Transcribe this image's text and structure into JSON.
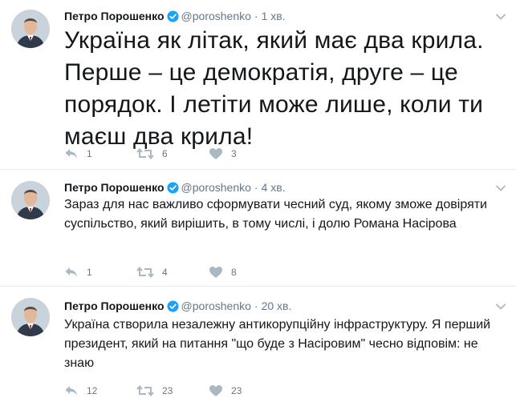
{
  "tweets": [
    {
      "name": "Петро Порошенко",
      "handle": "@poroshenko",
      "separator": "·",
      "time": "1 хв.",
      "text": "Україна як літак, який має два крила. Перше – це демократія, друге – це порядок. І летіти може лише, коли ти маєш два крила!",
      "replies": "1",
      "retweets": "6",
      "likes": "3"
    },
    {
      "name": "Петро Порошенко",
      "handle": "@poroshenko",
      "separator": "·",
      "time": "4 хв.",
      "text": "Зараз для нас важливо сформувати чесний суд, якому зможе довіряти суспільство, який вирішить, в тому числі, і долю Романа Насірова",
      "replies": "1",
      "retweets": "4",
      "likes": "8"
    },
    {
      "name": "Петро Порошенко",
      "handle": "@poroshenko",
      "separator": "·",
      "time": "20 хв.",
      "text": "Україна створила незалежну антикорупційну інфраструктуру. Я перший президент, який на питання \"що буде з Насіровим\" чесно відповім: не знаю",
      "replies": "12",
      "retweets": "23",
      "likes": "23"
    }
  ],
  "icons": {
    "verified": "verified-badge-icon",
    "caret": "chevron-down-icon",
    "reply": "reply-icon",
    "retweet": "retweet-icon",
    "like": "heart-icon"
  },
  "colors": {
    "verified": "#1da1f2",
    "text": "#14171a",
    "meta": "#657786",
    "icon": "#aab8c2",
    "divider": "#e6ecf0"
  }
}
